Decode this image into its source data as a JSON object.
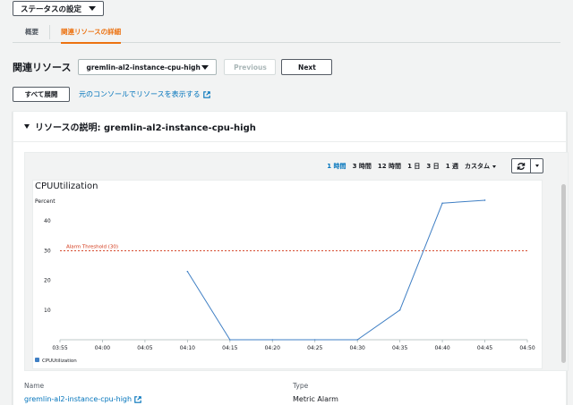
{
  "status": {
    "label": "ステータスの設定"
  },
  "tabs": [
    {
      "label": "概要",
      "active": false
    },
    {
      "label": "関連リソースの詳細",
      "active": true
    }
  ],
  "resource": {
    "label": "関連リソース",
    "selected": "gremlin-al2-instance-cpu-high",
    "previous_label": "Previous",
    "next_label": "Next"
  },
  "expand": {
    "button": "すべて展開",
    "console_link": "元のコンソールでリソースを表示する"
  },
  "panel": {
    "title": "リソースの説明: gremlin-al2-instance-cpu-high"
  },
  "time_ranges": [
    {
      "label": "1 時間",
      "active": true
    },
    {
      "label": "3 時間",
      "active": false
    },
    {
      "label": "12 時間",
      "active": false
    },
    {
      "label": "1 日",
      "active": false
    },
    {
      "label": "3 日",
      "active": false
    },
    {
      "label": "1 週",
      "active": false
    },
    {
      "label": "カスタム",
      "active": false
    }
  ],
  "chart_data": {
    "type": "line",
    "title": "CPUUtilization",
    "ylabel": "Percent",
    "x": [
      "03:55",
      "04:00",
      "04:05",
      "04:10",
      "04:15",
      "04:20",
      "04:25",
      "04:30",
      "04:35",
      "04:40",
      "04:45",
      "04:50"
    ],
    "yticks": [
      10,
      20,
      30,
      40
    ],
    "ylim": [
      0,
      50
    ],
    "series": [
      {
        "name": "CPUUtilization",
        "color": "#3f7fc4",
        "points": [
          [
            "04:10",
            23
          ],
          [
            "04:15",
            0
          ],
          [
            "04:20",
            0
          ],
          [
            "04:25",
            0
          ],
          [
            "04:30",
            0
          ],
          [
            "04:35",
            10
          ],
          [
            "04:40",
            46
          ],
          [
            "04:45",
            47
          ]
        ]
      }
    ],
    "threshold": {
      "label": "Alarm Threshold (30)",
      "value": 30,
      "color": "#d13212"
    }
  },
  "details": [
    {
      "label": "Name",
      "value": "gremlin-al2-instance-cpu-high",
      "is_link": true
    },
    {
      "label": "Type",
      "value": "Metric Alarm",
      "is_link": false
    }
  ]
}
